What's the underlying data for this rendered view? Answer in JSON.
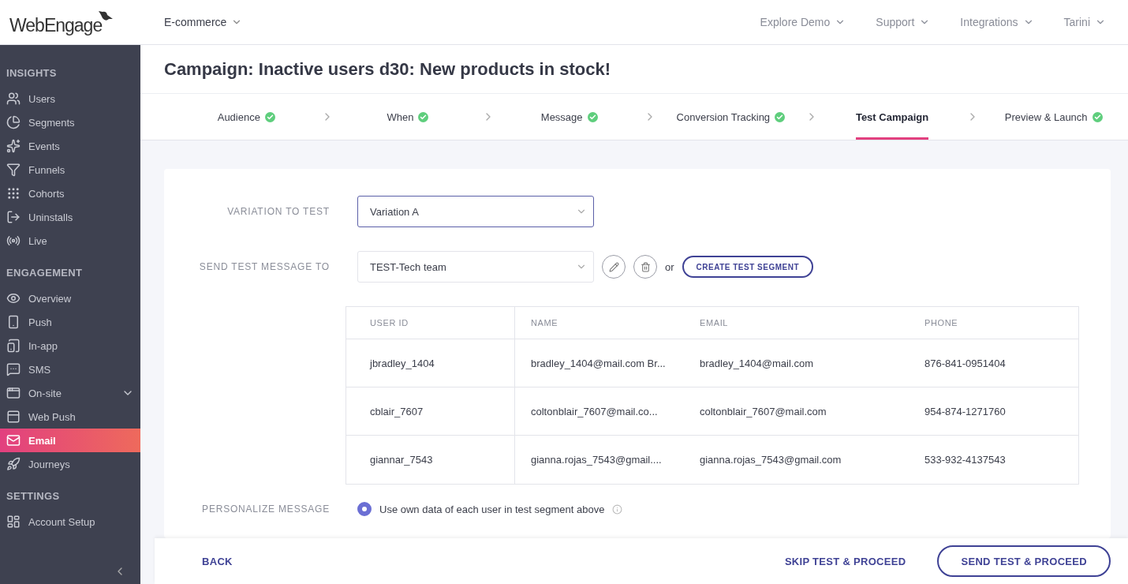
{
  "logo": {
    "text": "WebEngage"
  },
  "topbar": {
    "project": "E-commerce",
    "menus": [
      "Explore Demo",
      "Support",
      "Integrations",
      "Tarini"
    ]
  },
  "sidebar": {
    "sections": [
      {
        "title": "INSIGHTS",
        "items": [
          {
            "label": "Users",
            "selected": false,
            "expandable": false
          },
          {
            "label": "Segments",
            "selected": false,
            "expandable": false
          },
          {
            "label": "Events",
            "selected": false,
            "expandable": false
          },
          {
            "label": "Funnels",
            "selected": false,
            "expandable": false
          },
          {
            "label": "Cohorts",
            "selected": false,
            "expandable": false
          },
          {
            "label": "Uninstalls",
            "selected": false,
            "expandable": false
          },
          {
            "label": "Live",
            "selected": false,
            "expandable": false
          }
        ]
      },
      {
        "title": "ENGAGEMENT",
        "items": [
          {
            "label": "Overview",
            "selected": false,
            "expandable": false
          },
          {
            "label": "Push",
            "selected": false,
            "expandable": false
          },
          {
            "label": "In-app",
            "selected": false,
            "expandable": false
          },
          {
            "label": "SMS",
            "selected": false,
            "expandable": false
          },
          {
            "label": "On-site",
            "selected": false,
            "expandable": true
          },
          {
            "label": "Web Push",
            "selected": false,
            "expandable": false
          },
          {
            "label": "Email",
            "selected": true,
            "expandable": false
          },
          {
            "label": "Journeys",
            "selected": false,
            "expandable": false
          }
        ]
      },
      {
        "title": "SETTINGS",
        "items": [
          {
            "label": "Account Setup",
            "selected": false,
            "expandable": false
          }
        ]
      }
    ]
  },
  "page_title": "Campaign: Inactive users d30: New products in stock!",
  "steps": [
    {
      "label": "Audience",
      "done": true,
      "selected": false
    },
    {
      "label": "When",
      "done": true,
      "selected": false
    },
    {
      "label": "Message",
      "done": true,
      "selected": false
    },
    {
      "label": "Conversion Tracking",
      "done": true,
      "selected": false
    },
    {
      "label": "Test Campaign",
      "done": false,
      "selected": true
    },
    {
      "label": "Preview & Launch",
      "done": true,
      "selected": false
    }
  ],
  "form": {
    "variation": {
      "label": "VARIATION TO TEST",
      "value": "Variation A"
    },
    "send_to": {
      "label": "SEND TEST MESSAGE TO",
      "value": "TEST-Tech team",
      "or": "or",
      "create_button": "CREATE TEST SEGMENT"
    },
    "table": {
      "columns": [
        "USER ID",
        "NAME",
        "EMAIL",
        "PHONE"
      ],
      "rows": [
        [
          "jbradley_1404",
          "bradley_1404@mail.com Br...",
          "bradley_1404@mail.com",
          "876-841-0951404"
        ],
        [
          "cblair_7607",
          "coltonblair_7607@mail.co...",
          "coltonblair_7607@mail.com",
          "954-874-1271760"
        ],
        [
          "giannar_7543",
          "gianna.rojas_7543@gmail....",
          "gianna.rojas_7543@gmail.com",
          "533-932-4137543"
        ]
      ]
    },
    "personalize": {
      "label": "PERSONALIZE MESSAGE",
      "option": "Use own data of each user in test segment above",
      "selected": true
    }
  },
  "footer": {
    "back": "BACK",
    "skip": "SKIP TEST & PROCEED",
    "send": "SEND TEST & PROCEED"
  }
}
